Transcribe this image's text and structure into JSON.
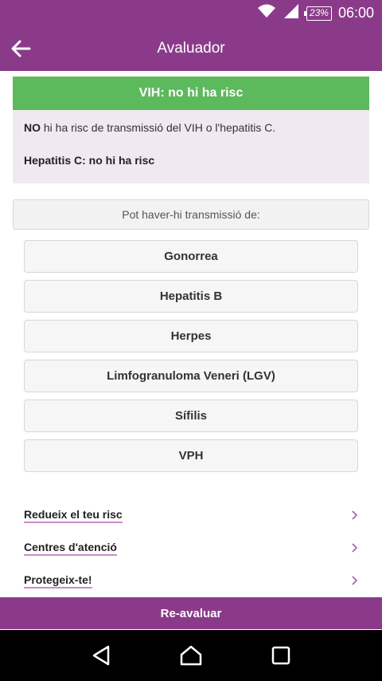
{
  "status_bar": {
    "battery": "23%",
    "time": "06:00"
  },
  "app_bar": {
    "title": "Avaluador"
  },
  "result": {
    "header": "VIH: no hi ha risc",
    "line1_prefix": "NO",
    "line1_rest": " hi ha risc de transmissió del VIH o l'hepatitis C.",
    "line2": "Hepatitis C: no hi ha risc"
  },
  "section": {
    "title": "Pot haver-hi transmissió de:"
  },
  "infections": [
    {
      "label": "Gonorrea"
    },
    {
      "label": "Hepatitis B"
    },
    {
      "label": "Herpes"
    },
    {
      "label": "Limfogranuloma Veneri (LGV)"
    },
    {
      "label": "Sífilis"
    },
    {
      "label": "VPH"
    }
  ],
  "links": [
    {
      "label": "Redueix el teu risc"
    },
    {
      "label": "Centres d'atenció"
    },
    {
      "label": "Protegeix-te!"
    }
  ],
  "bottom_button": {
    "label": "Re-avaluar"
  },
  "colors": {
    "primary": "#8b3a8a",
    "success": "#5cb95c",
    "panel": "#f0e9f2"
  }
}
